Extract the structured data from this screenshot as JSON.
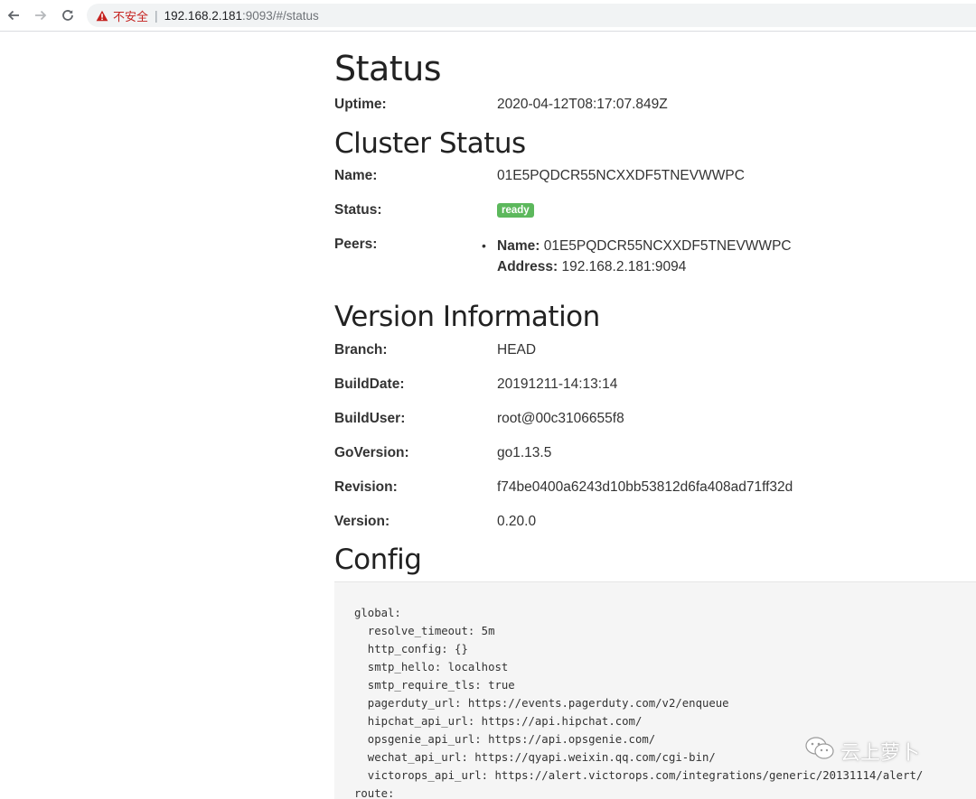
{
  "browser": {
    "insecure_label": "不安全",
    "separator": "|",
    "url_host": "192.168.2.181",
    "url_rest": ":9093/#/status"
  },
  "status": {
    "title": "Status",
    "uptime_label": "Uptime:",
    "uptime_value": "2020-04-12T08:17:07.849Z"
  },
  "cluster": {
    "title": "Cluster Status",
    "name_label": "Name:",
    "name_value": "01E5PQDCR55NCXXDF5TNEVWWPC",
    "status_label": "Status:",
    "status_badge": "ready",
    "peers_label": "Peers:",
    "peers": [
      {
        "name_label": "Name:",
        "name_value": "01E5PQDCR55NCXXDF5TNEVWWPC",
        "address_label": "Address:",
        "address_value": "192.168.2.181:9094"
      }
    ]
  },
  "version": {
    "title": "Version Information",
    "rows": [
      {
        "label": "Branch:",
        "value": "HEAD"
      },
      {
        "label": "BuildDate:",
        "value": "20191211-14:13:14"
      },
      {
        "label": "BuildUser:",
        "value": "root@00c3106655f8"
      },
      {
        "label": "GoVersion:",
        "value": "go1.13.5"
      },
      {
        "label": "Revision:",
        "value": "f74be0400a6243d10bb53812d6fa408ad71ff32d"
      },
      {
        "label": "Version:",
        "value": "0.20.0"
      }
    ]
  },
  "config": {
    "title": "Config",
    "text": "global:\n  resolve_timeout: 5m\n  http_config: {}\n  smtp_hello: localhost\n  smtp_require_tls: true\n  pagerduty_url: https://events.pagerduty.com/v2/enqueue\n  hipchat_api_url: https://api.hipchat.com/\n  opsgenie_api_url: https://api.opsgenie.com/\n  wechat_api_url: https://qyapi.weixin.qq.com/cgi-bin/\n  victorops_api_url: https://alert.victorops.com/integrations/generic/20131114/alert/\nroute:"
  },
  "watermark": {
    "text": "云上萝卜",
    "icon": "wechat-icon"
  },
  "colors": {
    "badge_ready": "#5cb85c",
    "insecure_red": "#c5221f",
    "config_bg": "#f5f5f5"
  }
}
